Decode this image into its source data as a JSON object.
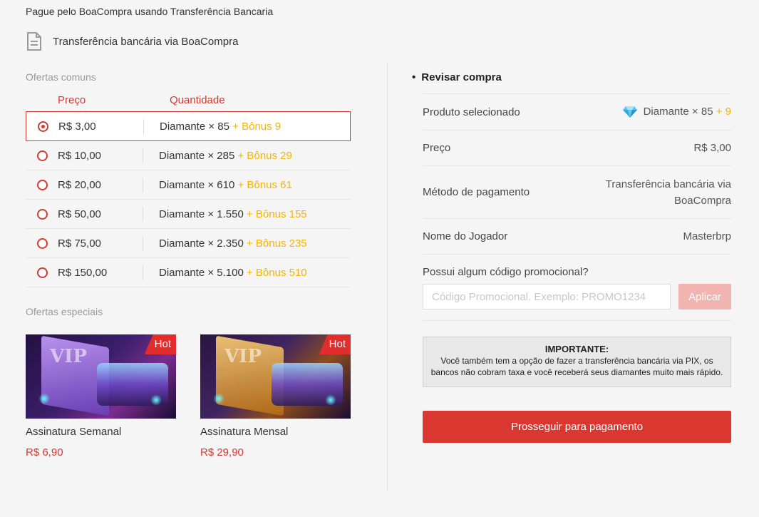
{
  "header": {
    "title": "Pague pelo BoaCompra usando Transferência Bancaria",
    "method_label": "Transferência bancária via BoaCompra",
    "method_icon": "document-icon"
  },
  "offers": {
    "section_label": "Ofertas comuns",
    "price_header": "Preço",
    "qty_header": "Quantidade",
    "items": [
      {
        "price": "R$ 3,00",
        "qty": "Diamante × 85",
        "bonus": "+ Bônus 9",
        "selected": true
      },
      {
        "price": "R$ 10,00",
        "qty": "Diamante × 285",
        "bonus": "+ Bônus 29",
        "selected": false
      },
      {
        "price": "R$ 20,00",
        "qty": "Diamante × 610",
        "bonus": "+ Bônus 61",
        "selected": false
      },
      {
        "price": "R$ 50,00",
        "qty": "Diamante × 1.550",
        "bonus": "+ Bônus 155",
        "selected": false
      },
      {
        "price": "R$ 75,00",
        "qty": "Diamante × 2.350",
        "bonus": "+ Bônus 235",
        "selected": false
      },
      {
        "price": "R$ 150,00",
        "qty": "Diamante × 5.100",
        "bonus": "+ Bônus 510",
        "selected": false
      }
    ]
  },
  "special": {
    "section_label": "Ofertas especiais",
    "cards": [
      {
        "name": "Assinatura Semanal",
        "price": "R$ 6,90",
        "badge": "Hot",
        "image_label": "VIP"
      },
      {
        "name": "Assinatura Mensal",
        "price": "R$ 29,90",
        "badge": "Hot",
        "image_label": "VIP"
      }
    ]
  },
  "review": {
    "bullet": "•",
    "title": "Revisar compra",
    "product_label": "Produto selecionado",
    "product_value": "Diamante × 85",
    "product_bonus": "+ 9",
    "price_label": "Preço",
    "price_value": "R$ 3,00",
    "method_label": "Método de pagamento",
    "method_value_line1": "Transferência bancária via",
    "method_value_line2": "BoaCompra",
    "player_label": "Nome do Jogador",
    "player_value": "Masterbrp",
    "promo_question": "Possui algum código promocional?",
    "promo_placeholder": "Código Promocional. Exemplo: PROMO1234",
    "apply_label": "Aplicar",
    "important_title": "IMPORTANTE:",
    "important_text": "Você também tem a opção de fazer a transferência bancária via PIX, os bancos não cobram taxa e você receberá seus diamantes muito mais rápido.",
    "pay_label": "Prosseguir para pagamento"
  },
  "colors": {
    "accent": "#d33a31",
    "bonus": "#f5b400",
    "button": "#d93730",
    "button_disabled": "#f1b4b1"
  }
}
